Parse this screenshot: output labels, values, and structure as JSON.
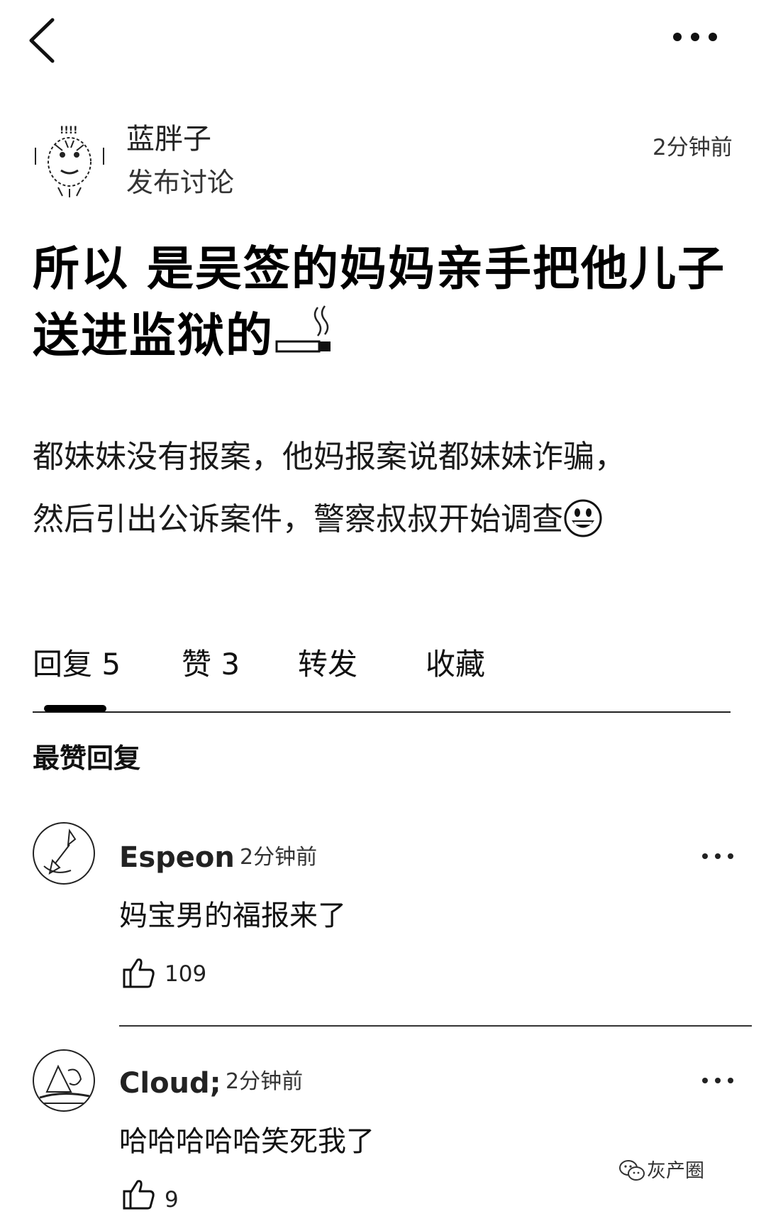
{
  "post": {
    "author_name": "蓝胖子",
    "author_action": "发布讨论",
    "time": "2分钟前",
    "title": "所以 是吴签的妈妈亲手把他儿子送进监狱的",
    "body_line1": "都妹妹没有报案，他妈报案说都妹妹诈骗，",
    "body_line2": "然后引出公诉案件，警察叔叔开始调查"
  },
  "tabs": [
    {
      "label": "回复 5"
    },
    {
      "label": "赞 3"
    },
    {
      "label": "转发"
    },
    {
      "label": "收藏"
    }
  ],
  "top_replies_heading": "最赞回复",
  "comments": [
    {
      "name": "Espeon",
      "time": "2分钟前",
      "text": "妈宝男的福报来了",
      "likes": "109"
    },
    {
      "name": "Cloud;",
      "time": "2分钟前",
      "text": "哈哈哈哈哈笑死我了",
      "likes": "9"
    }
  ],
  "watermark": "灰产圈",
  "icons": {
    "back": "back-chevron-icon",
    "more": "more-dots-icon",
    "like": "thumbs-up-icon",
    "cigarette": "cigarette-emoji-icon",
    "smile": "grinning-face-emoji-icon"
  }
}
